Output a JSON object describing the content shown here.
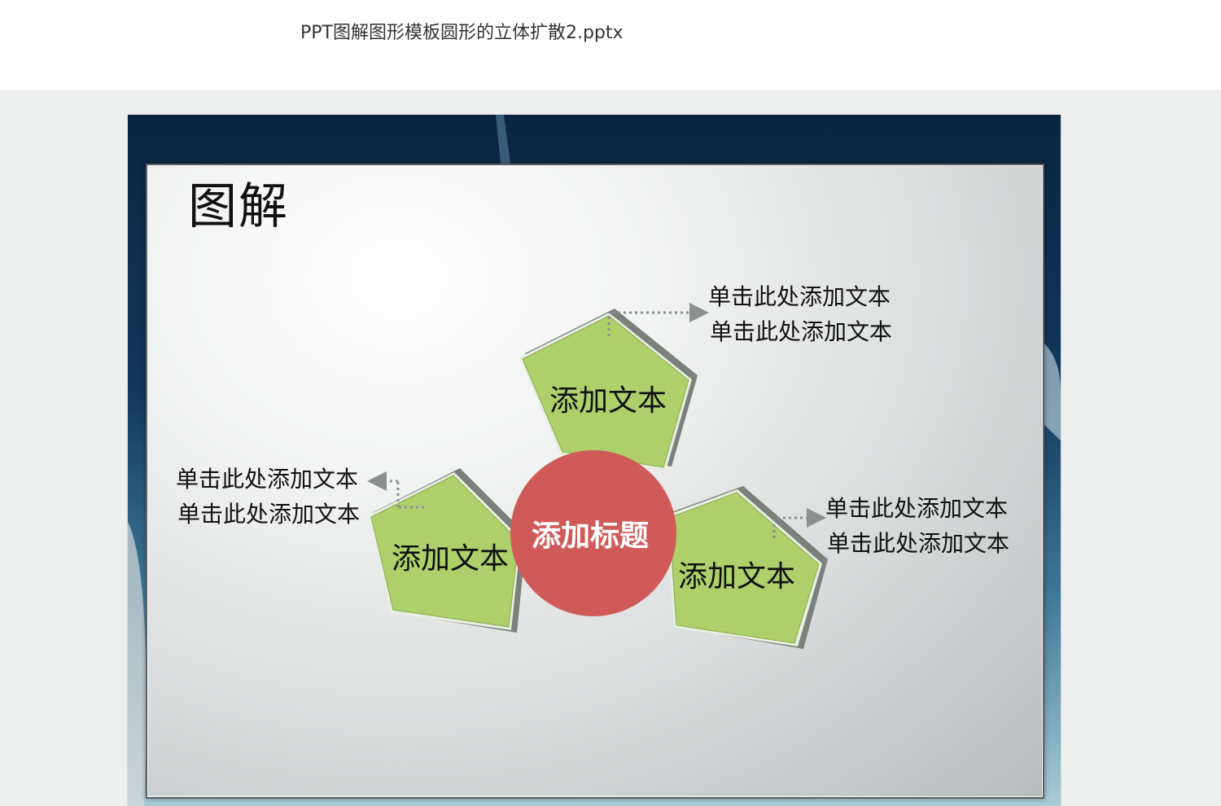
{
  "document": {
    "title": "PPT图解图形模板圆形的立体扩散2.pptx"
  },
  "slide": {
    "title": "图解",
    "center": {
      "label": "添加标题",
      "color": "#d05a58"
    },
    "pentagon_color": "#add06a",
    "nodes": [
      {
        "label": "添加文本",
        "callout": [
          "单击此处添加文本",
          "单击此处添加文本"
        ]
      },
      {
        "label": "添加文本",
        "callout": [
          "单击此处添加文本",
          "单击此处添加文本"
        ]
      },
      {
        "label": "添加文本",
        "callout": [
          "单击此处添加文本",
          "单击此处添加文本"
        ]
      }
    ]
  }
}
